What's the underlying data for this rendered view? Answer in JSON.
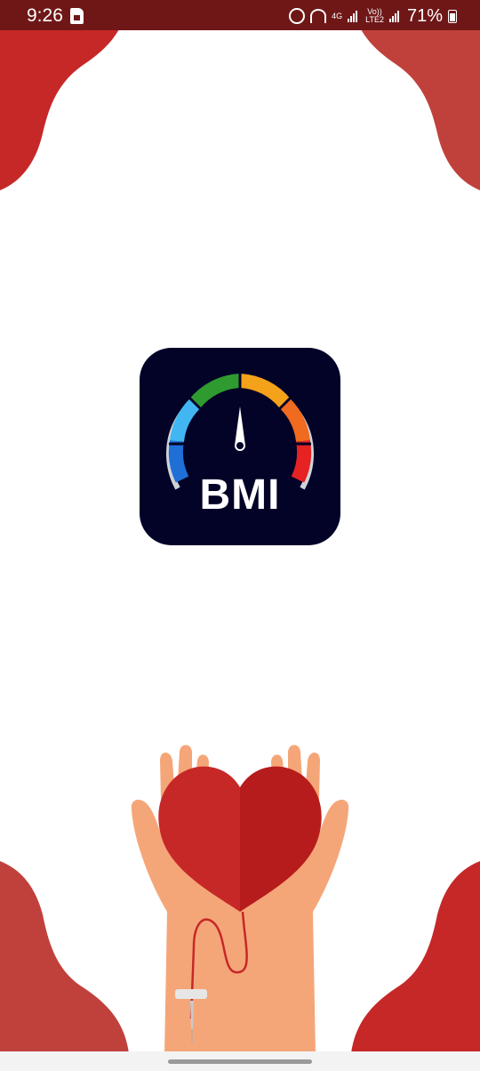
{
  "status_bar": {
    "time": "9:26",
    "network_label": "4G",
    "volte_label": "Vo))",
    "lte_label": "LTE2",
    "battery_percent": "71%",
    "icons": [
      "sim-card-icon",
      "alarm-icon",
      "hotspot-icon",
      "signal-icon",
      "battery-icon"
    ]
  },
  "splash": {
    "logo_text": "BMI",
    "gauge_colors": [
      "#1f6fd6",
      "#41b6f2",
      "#2f9a2f",
      "#f5a21b",
      "#f06a1f",
      "#e62222"
    ]
  },
  "colors": {
    "accent_red": "#c62828",
    "dark_red": "#b71c1c",
    "logo_bg": "#020327",
    "skin": "#f5a678"
  }
}
